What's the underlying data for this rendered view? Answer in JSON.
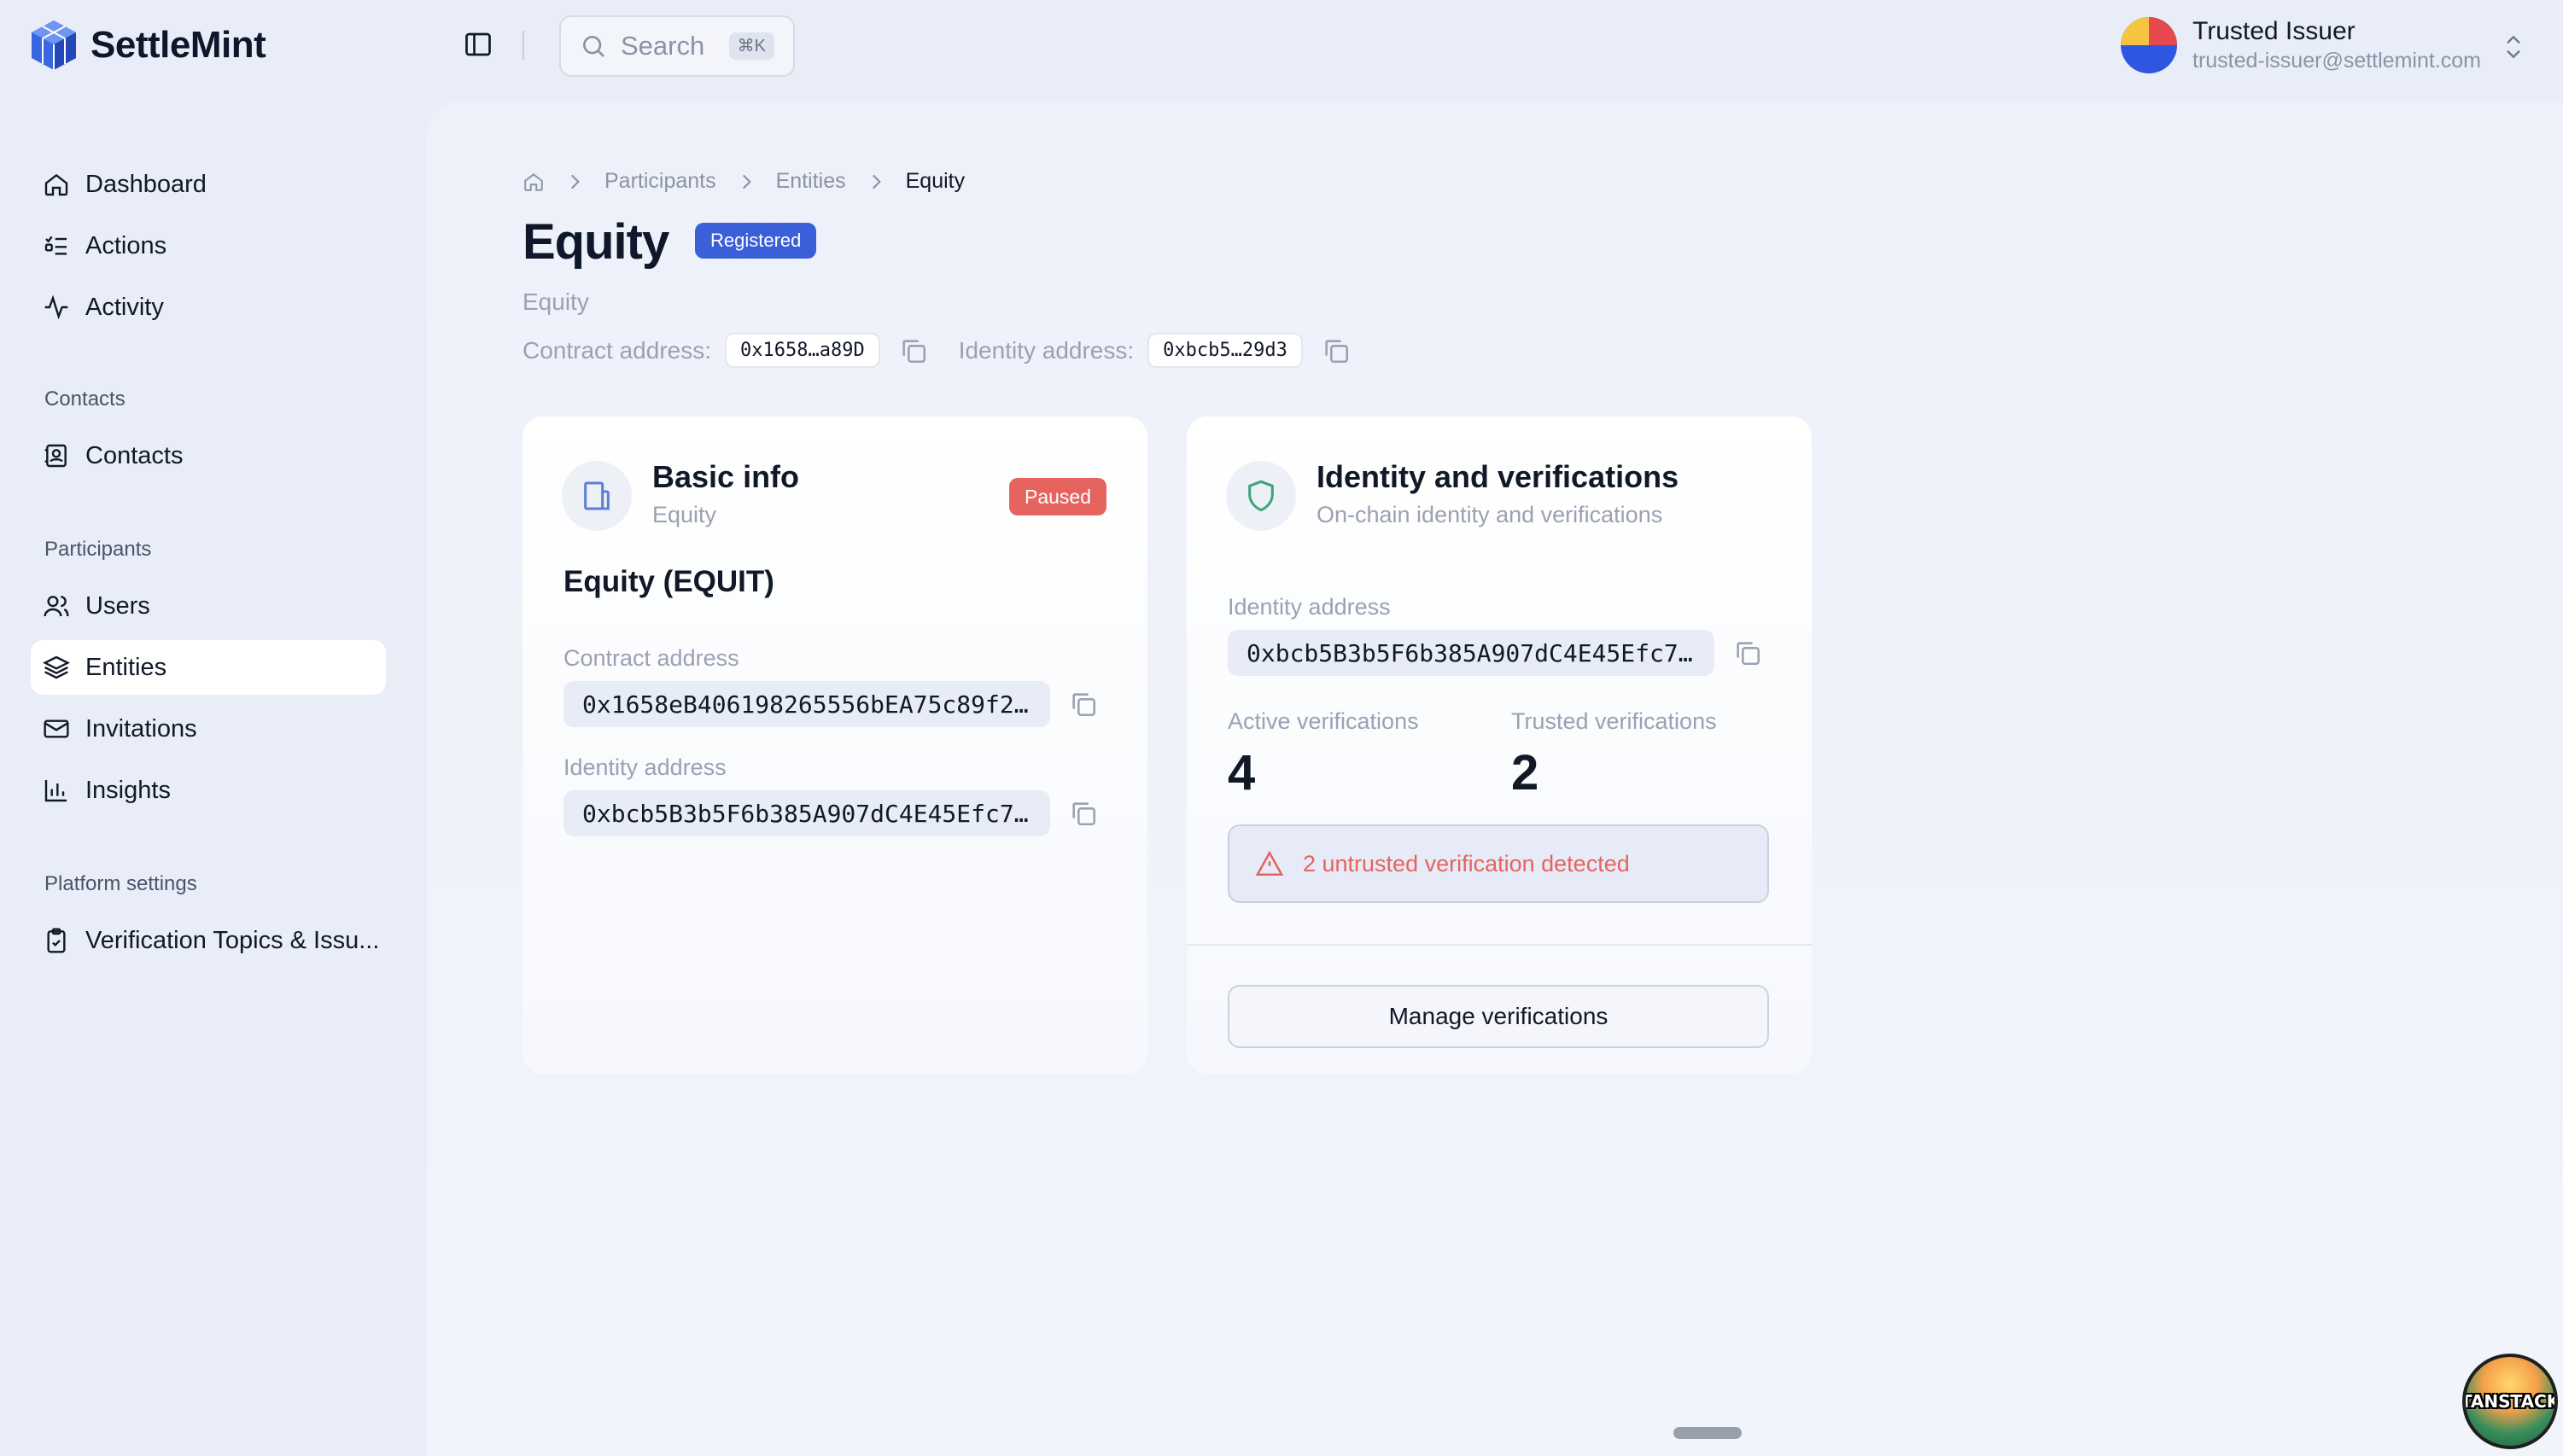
{
  "app": {
    "name": "SettleMint"
  },
  "search": {
    "label": "Search",
    "shortcut": "⌘K"
  },
  "user": {
    "name": "Trusted Issuer",
    "email": "trusted-issuer@settlemint.com"
  },
  "sidebar": {
    "items": [
      {
        "label": "Dashboard",
        "icon": "home-icon"
      },
      {
        "label": "Actions",
        "icon": "list-checks-icon"
      },
      {
        "label": "Activity",
        "icon": "activity-icon"
      }
    ],
    "contacts_section": "Contacts",
    "contacts_items": [
      {
        "label": "Contacts",
        "icon": "contact-book-icon"
      }
    ],
    "participants_section": "Participants",
    "participants_items": [
      {
        "label": "Users",
        "icon": "users-icon"
      },
      {
        "label": "Entities",
        "icon": "layers-icon",
        "active": true
      },
      {
        "label": "Invitations",
        "icon": "mail-icon"
      },
      {
        "label": "Insights",
        "icon": "bar-chart-icon"
      }
    ],
    "platform_section": "Platform settings",
    "platform_items": [
      {
        "label": "Verification Topics & Issu...",
        "icon": "clipboard-check-icon"
      }
    ]
  },
  "breadcrumb": {
    "items": [
      "Participants",
      "Entities"
    ],
    "current": "Equity"
  },
  "page": {
    "title": "Equity",
    "status_badge": "Registered",
    "subtitle": "Equity",
    "contract_label": "Contract address:",
    "contract_short": "0x1658…a89D",
    "identity_label": "Identity address:",
    "identity_short": "0xbcb5…29d3"
  },
  "basic_info": {
    "title": "Basic info",
    "subtitle": "Equity",
    "status": "Paused",
    "asset_name": "Equity (EQUIT)",
    "contract_label": "Contract address",
    "contract_value": "0x1658eB406198265556bEA75c89f2…",
    "identity_label": "Identity address",
    "identity_value": "0xbcb5B3b5F6b385A907dC4E45Efc7…"
  },
  "identity_card": {
    "title": "Identity and verifications",
    "subtitle": "On-chain identity and verifications",
    "identity_label": "Identity address",
    "identity_value": "0xbcb5B3b5F6b385A907dC4E45Efc7…",
    "active_label": "Active verifications",
    "active_value": "4",
    "trusted_label": "Trusted verifications",
    "trusted_value": "2",
    "alert_text": "2 untrusted verification detected",
    "button_label": "Manage verifications"
  },
  "devtools": {
    "label": "TANSTACK"
  },
  "colors": {
    "accent": "#3b5fd9",
    "danger": "#e5645f",
    "background": "#e9edf8"
  }
}
